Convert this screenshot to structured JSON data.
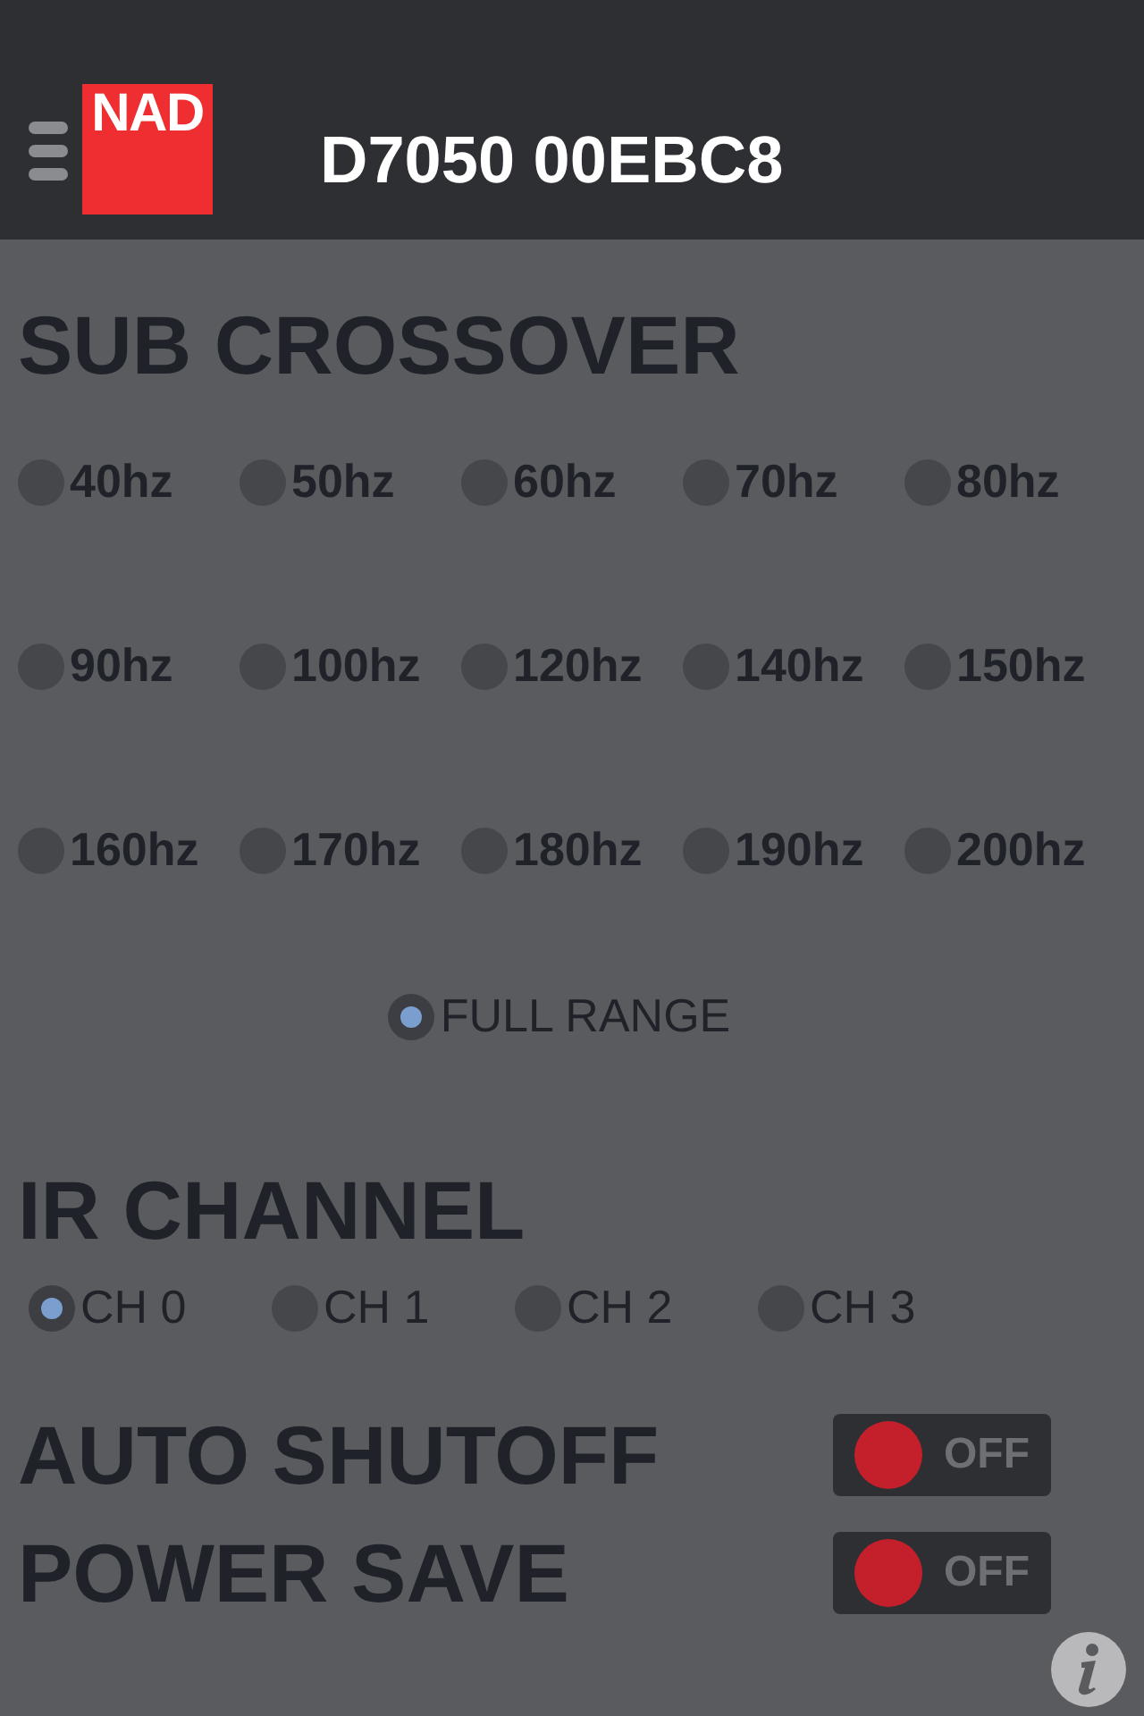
{
  "header": {
    "logo": "NAD",
    "title": "D7050 00EBC8"
  },
  "sub_crossover": {
    "heading": "SUB CROSSOVER",
    "options": [
      {
        "label": "40hz",
        "selected": false
      },
      {
        "label": "50hz",
        "selected": false
      },
      {
        "label": "60hz",
        "selected": false
      },
      {
        "label": "70hz",
        "selected": false
      },
      {
        "label": "80hz",
        "selected": false
      },
      {
        "label": "90hz",
        "selected": false
      },
      {
        "label": "100hz",
        "selected": false
      },
      {
        "label": "120hz",
        "selected": false
      },
      {
        "label": "140hz",
        "selected": false
      },
      {
        "label": "150hz",
        "selected": false
      },
      {
        "label": "160hz",
        "selected": false
      },
      {
        "label": "170hz",
        "selected": false
      },
      {
        "label": "180hz",
        "selected": false
      },
      {
        "label": "190hz",
        "selected": false
      },
      {
        "label": "200hz",
        "selected": false
      }
    ],
    "full_range": {
      "label": "FULL RANGE",
      "selected": true
    }
  },
  "ir_channel": {
    "heading": "IR CHANNEL",
    "options": [
      {
        "label": "CH 0",
        "selected": true
      },
      {
        "label": "CH 1",
        "selected": false
      },
      {
        "label": "CH 2",
        "selected": false
      },
      {
        "label": "CH 3",
        "selected": false
      }
    ]
  },
  "settings": [
    {
      "label": "AUTO SHUTOFF",
      "on": false,
      "state_text": "OFF"
    },
    {
      "label": "POWER SAVE",
      "on": false,
      "state_text": "OFF"
    }
  ]
}
